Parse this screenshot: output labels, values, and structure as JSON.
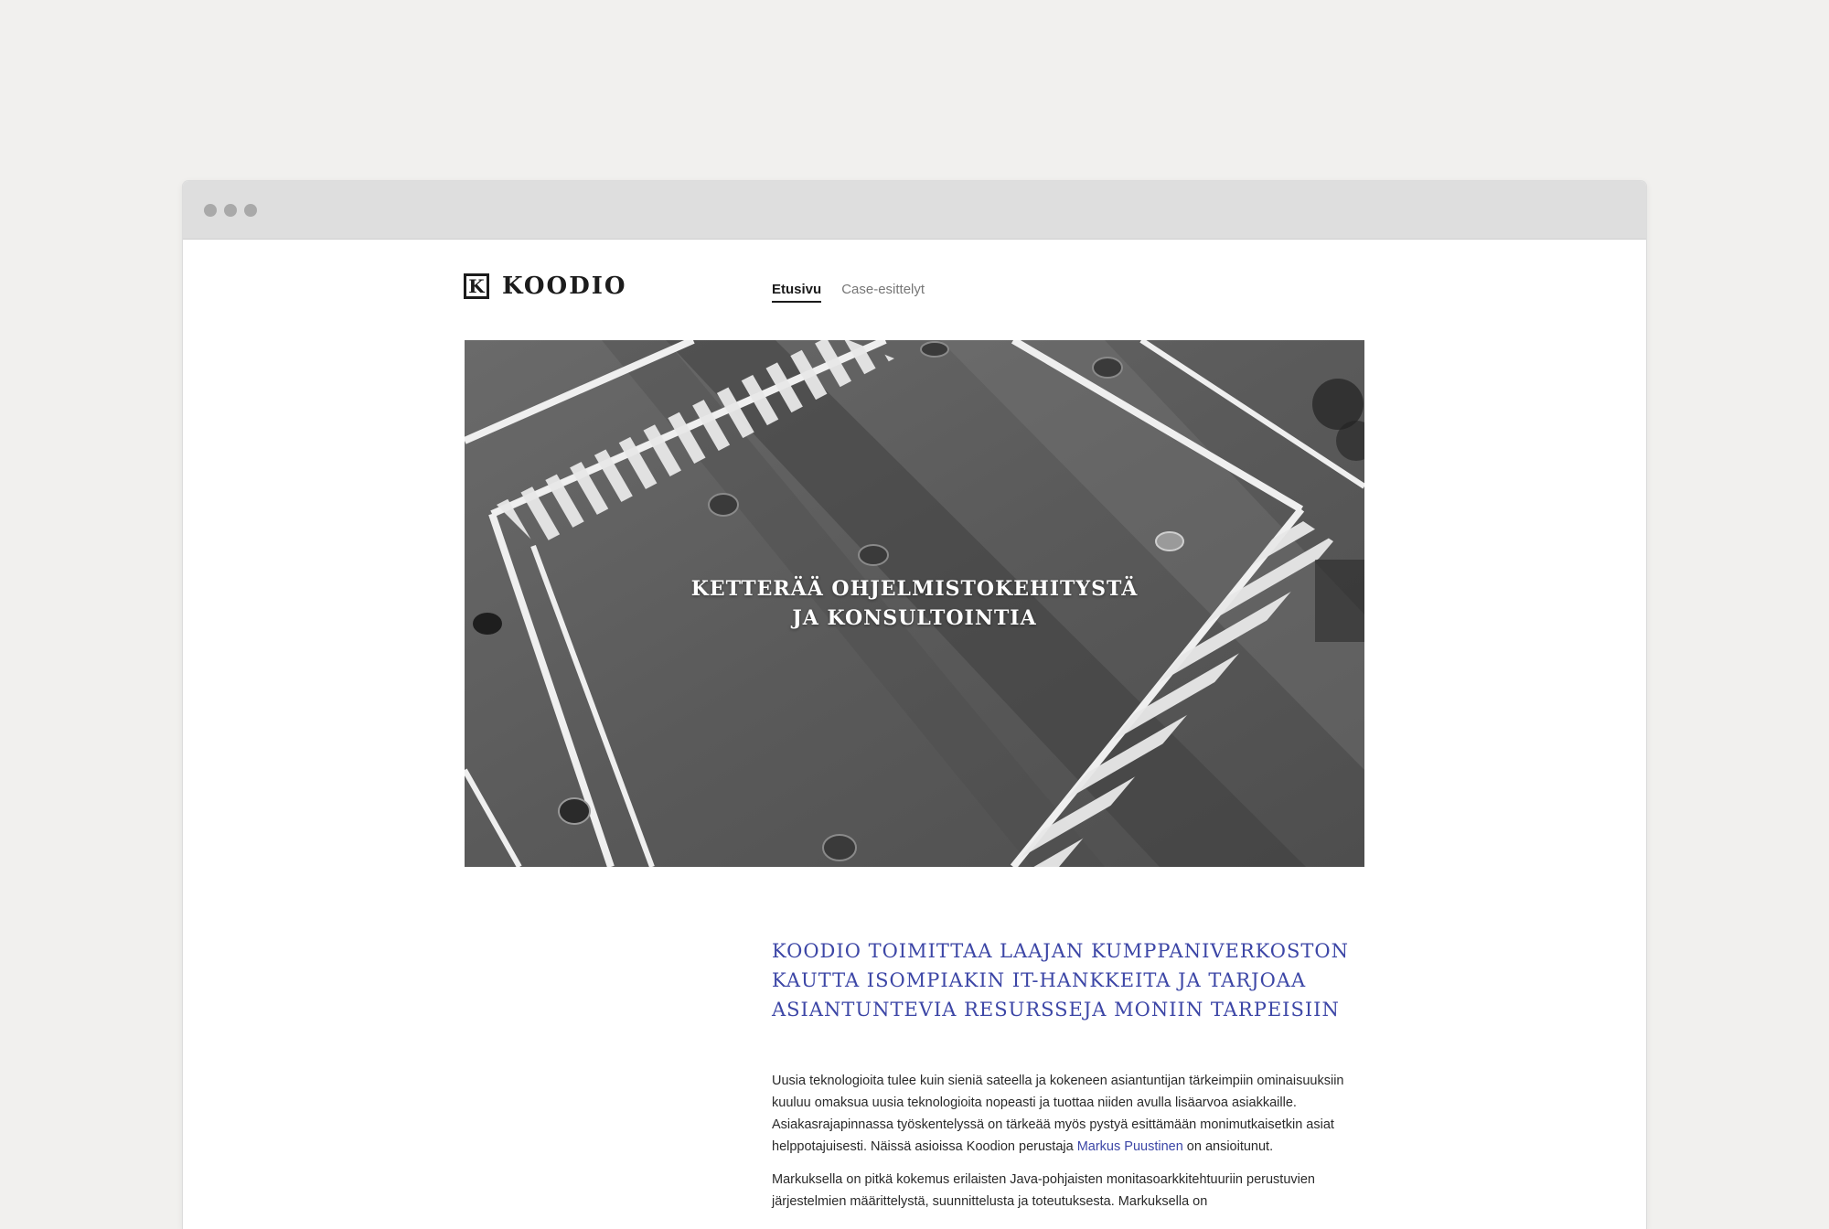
{
  "site": {
    "logo_mark": "K",
    "logo_text": "KOODIO"
  },
  "nav": {
    "items": [
      {
        "label": "Etusivu",
        "active": true
      },
      {
        "label": "Case-esittelyt",
        "active": false
      }
    ]
  },
  "hero": {
    "headline": "KETTERÄÄ OHJELMISTOKEHITYSTÄ JA KONSULTOINTIA"
  },
  "intro": {
    "heading": "KOODIO TOIMITTAA LAAJAN KUMPPANIVERKOSTON KAUTTA ISOMPIAKIN IT-HANKKEITA JA TARJOAA ASIANTUNTEVIA RESURSSEJA MONIIN TARPEISIIN",
    "paragraph1_before_link": "Uusia teknologioita tulee kuin sieniä sateella ja kokeneen asiantuntijan tärkeimpiin ominaisuuksiin kuuluu omaksua uusia teknologioita nopeasti ja tuottaa niiden avulla lisäarvoa asiakkaille. Asiakasrajapinnassa työskentelyssä on tärkeää myös pystyä esittämään monimutkaisetkin asiat helppotajuisesti. Näissä asioissa Koodion perustaja ",
    "paragraph1_link": "Markus Puustinen",
    "paragraph1_after_link": " on ansioitunut.",
    "paragraph2": "Markuksella on pitkä kokemus erilaisten Java-pohjaisten monitasoarkkitehtuuriin perustuvien järjestelmien määrittelystä, suunnittelusta ja toteutuksesta. Markuksella on"
  },
  "colors": {
    "accent": "#3c46a6",
    "background": "#f1f0ee",
    "titlebar": "#dedede"
  }
}
